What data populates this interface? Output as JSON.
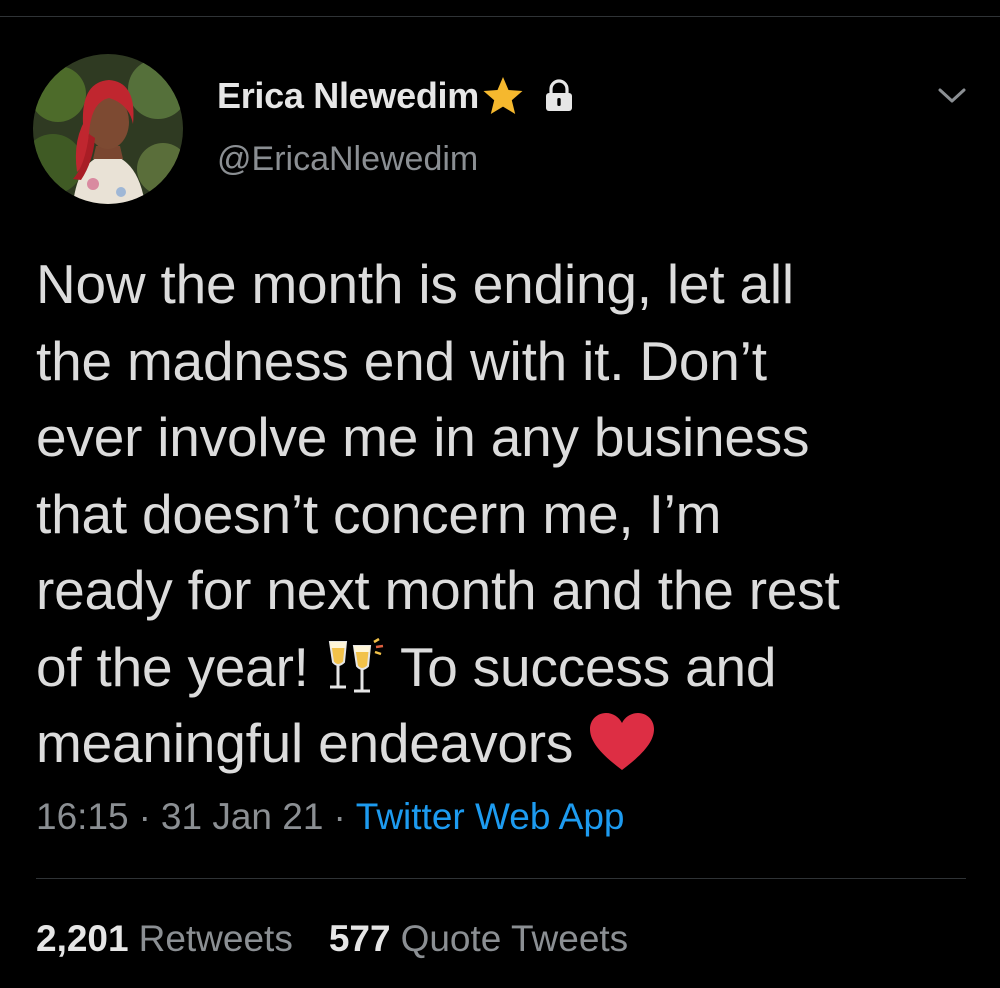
{
  "tweet": {
    "author": {
      "display_name": "Erica Nlewedim",
      "handle": "@EricaNlewedim",
      "badge_icon": "star-icon",
      "protected_icon": "lock-icon"
    },
    "text_lines": [
      "Now the month is ending, let all",
      "the madness end with it. Don’t",
      "ever involve me in any business",
      "that doesn’t concern me, I’m",
      "ready for next month and the rest",
      "of the year! 🥂 To success and",
      "meaningful endeavors ❤️"
    ],
    "line6_before_emoji": "of the year!",
    "line6_after_emoji": "To success and",
    "line7_text": "meaningful endeavors",
    "time": "16:15",
    "separator": "·",
    "date": "31 Jan 21",
    "source": "Twitter Web App",
    "stats": {
      "retweets_count": "2,201",
      "retweets_label": "Retweets",
      "quote_count": "577",
      "quote_label": "Quote Tweets"
    }
  },
  "colors": {
    "background": "#000000",
    "text": "#d9d9d9",
    "secondary": "#8b8f93",
    "link": "#1d9bf0",
    "star": "#f5b82e",
    "heart": "#dd2e44"
  }
}
